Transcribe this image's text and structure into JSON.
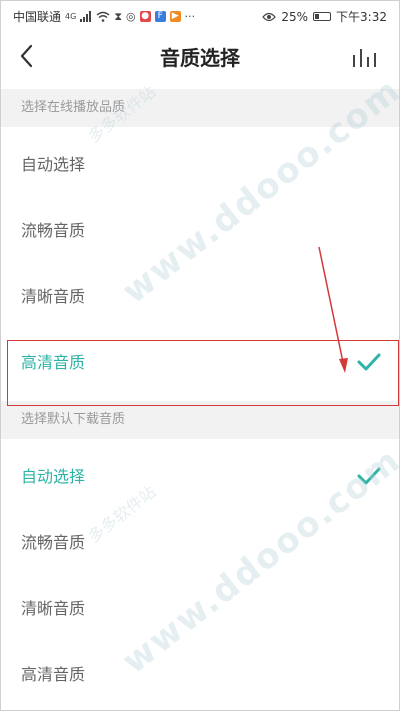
{
  "status_bar": {
    "carrier": "中国联通",
    "network": "4G",
    "battery": "25%",
    "battery_level": 0.25,
    "time": "下午3:32"
  },
  "header": {
    "title": "音质选择",
    "back_icon": "chevron-left-icon",
    "eq_icon": "equalizer-icon"
  },
  "online_section": {
    "title": "选择在线播放品质",
    "options": [
      {
        "label": "自动选择",
        "selected": false
      },
      {
        "label": "流畅音质",
        "selected": false
      },
      {
        "label": "清晰音质",
        "selected": false
      },
      {
        "label": "高清音质",
        "selected": true
      }
    ]
  },
  "download_section": {
    "title": "选择默认下载音质",
    "options": [
      {
        "label": "自动选择",
        "selected": true
      },
      {
        "label": "流畅音质",
        "selected": false
      },
      {
        "label": "清晰音质",
        "selected": false
      },
      {
        "label": "高清音质",
        "selected": false
      }
    ]
  },
  "watermark": {
    "text": "www.ddooo.com",
    "cn_text": "多多软件站"
  },
  "colors": {
    "accent": "#2fb3a6",
    "highlight": "#d23a3a",
    "section_bg": "#f2f2f2"
  }
}
